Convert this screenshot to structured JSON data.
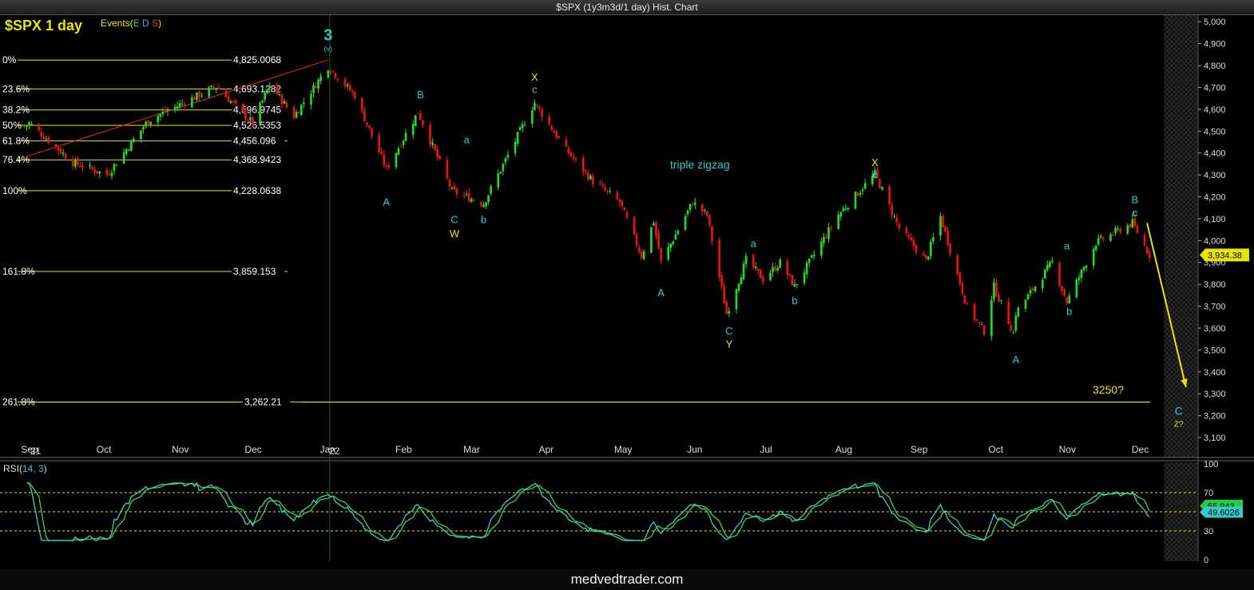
{
  "window": {
    "title": "$SPX (1y3m3d/1 day) Hist. Chart"
  },
  "header": {
    "symbol_label": "$SPX 1 day",
    "events_label": "Events(",
    "events_e": "E",
    "events_d": "D",
    "events_s": "S",
    "events_close": ")"
  },
  "footer": {
    "brand": "medvedtrader.com"
  },
  "colors": {
    "up": "#22dd22",
    "down": "#ee1111",
    "fib": "#e6e600",
    "wave": "#22cccc",
    "yellow": "#e6e600",
    "rsi_a": "#33dddd",
    "rsi_b": "#44dd44"
  },
  "chart_data": {
    "type": "candlestick",
    "price_axis": {
      "ticks": [
        "5,000",
        "4,900",
        "4,800",
        "4,700",
        "4,600",
        "4,500",
        "4,400",
        "4,300",
        "4,200",
        "4,100",
        "4,000",
        "3,900",
        "3,800",
        "3,700",
        "3,600",
        "3,500",
        "3,400",
        "3,300",
        "3,200",
        "3,100"
      ],
      "range": [
        3060,
        5030
      ],
      "last_price": "3,934.38"
    },
    "time_axis": {
      "labels": [
        "Sep",
        "'21",
        "Oct",
        "Nov",
        "Dec",
        "Jan",
        "'22",
        "Feb",
        "Mar",
        "Apr",
        "May",
        "Jun",
        "Jul",
        "Aug",
        "Sep",
        "Oct",
        "Nov",
        "Dec"
      ]
    },
    "fibonacci": {
      "levels": [
        {
          "label": "0%",
          "value": 4825.0068,
          "value_text": "4,825.0068"
        },
        {
          "label": "23.6%",
          "value": 4693.1282,
          "value_text": "4,693.1282"
        },
        {
          "label": "38.2%",
          "value": 4596.9745,
          "value_text": "4,596.9745"
        },
        {
          "label": "50%",
          "value": 4526.5353,
          "value_text": "4,526.5353"
        },
        {
          "label": "61.8%",
          "value": 4456.096,
          "value_text": "4,456.096"
        },
        {
          "label": "76.4%",
          "value": 4368.9423,
          "value_text": "4,368.9423"
        },
        {
          "label": "100%",
          "value": 4228.0638,
          "value_text": "4,228.0638"
        },
        {
          "label": "161.8%",
          "value": 3859.153,
          "value_text": "3,859.153"
        },
        {
          "label": "261.8%",
          "value": 3262.21,
          "value_text": "3,262.21"
        }
      ]
    },
    "annotations": [
      {
        "text": "3",
        "date": "2022-01-03",
        "price": 4915,
        "color": "wave",
        "size": 20,
        "bold": true
      },
      {
        "text": "(v)",
        "date": "2022-01-03",
        "price": 4865,
        "color": "wave",
        "size": 9
      },
      {
        "text": "A",
        "date": "2022-01-27",
        "price": 4160,
        "color": "wave"
      },
      {
        "text": "B",
        "date": "2022-02-10",
        "price": 4650,
        "color": "wave"
      },
      {
        "text": "a",
        "date": "2022-03-01",
        "price": 4445,
        "color": "wave"
      },
      {
        "text": "C",
        "date": "2022-02-24",
        "price": 4080,
        "color": "wave"
      },
      {
        "text": "W",
        "date": "2022-02-24",
        "price": 4015,
        "color": "yellow"
      },
      {
        "text": "b",
        "date": "2022-03-08",
        "price": 4080,
        "color": "wave"
      },
      {
        "text": "X",
        "date": "2022-03-29",
        "price": 4730,
        "color": "yellow"
      },
      {
        "text": "c",
        "date": "2022-03-29",
        "price": 4675,
        "color": "wave"
      },
      {
        "text": "triple zigzag",
        "date": "2022-06-05",
        "price": 4330,
        "color": "wave",
        "size": 14
      },
      {
        "text": "A",
        "date": "2022-05-20",
        "price": 3745,
        "color": "wave"
      },
      {
        "text": "a",
        "date": "2022-06-27",
        "price": 3970,
        "color": "wave"
      },
      {
        "text": "b",
        "date": "2022-07-14",
        "price": 3710,
        "color": "wave"
      },
      {
        "text": "C",
        "date": "2022-06-17",
        "price": 3570,
        "color": "wave"
      },
      {
        "text": "Y",
        "date": "2022-06-17",
        "price": 3510,
        "color": "yellow"
      },
      {
        "text": "X",
        "date": "2022-08-16",
        "price": 4340,
        "color": "yellow"
      },
      {
        "text": "c",
        "date": "2022-08-16",
        "price": 4285,
        "color": "wave",
        "bold": true
      },
      {
        "text": "A",
        "date": "2022-10-13",
        "price": 3440,
        "color": "wave"
      },
      {
        "text": "a",
        "date": "2022-11-03",
        "price": 3960,
        "color": "wave"
      },
      {
        "text": "b",
        "date": "2022-11-04",
        "price": 3660,
        "color": "wave"
      },
      {
        "text": "B",
        "date": "2022-12-01",
        "price": 4170,
        "color": "wave"
      },
      {
        "text": "c",
        "date": "2022-12-01",
        "price": 4110,
        "color": "wave",
        "bold": true
      },
      {
        "text": "3250?",
        "date": "2022-11-20",
        "price": 3300,
        "color": "yellow",
        "size": 14
      },
      {
        "text": "C",
        "date": "2022-12-19",
        "price": 3205,
        "color": "wave",
        "size": 14
      },
      {
        "text": "Z?",
        "date": "2022-12-19",
        "price": 3150,
        "color": "yellow",
        "size": 10
      }
    ],
    "projection": {
      "from_date": "2022-12-06",
      "from_price": 4080,
      "to_date": "2022-12-22",
      "to_price": 3330
    },
    "swing_line": {
      "from_date": "2021-09-01",
      "from_price": 4385,
      "to_date": "2022-01-03",
      "to_price": 4825
    },
    "anchors": [
      [
        "2021-08-31",
        4520
      ],
      [
        "2021-09-02",
        4537
      ],
      [
        "2021-09-20",
        4358
      ],
      [
        "2021-10-04",
        4300
      ],
      [
        "2021-10-21",
        4549
      ],
      [
        "2021-11-18",
        4704
      ],
      [
        "2021-11-30",
        4567
      ],
      [
        "2021-12-03",
        4538
      ],
      [
        "2021-12-10",
        4712
      ],
      [
        "2021-12-20",
        4568
      ],
      [
        "2022-01-03",
        4796
      ],
      [
        "2022-01-14",
        4663
      ],
      [
        "2022-01-27",
        4326
      ],
      [
        "2022-02-09",
        4587
      ],
      [
        "2022-02-23",
        4225
      ],
      [
        "2022-03-08",
        4170
      ],
      [
        "2022-03-29",
        4631
      ],
      [
        "2022-04-11",
        4412
      ],
      [
        "2022-04-22",
        4271
      ],
      [
        "2022-05-03",
        4175
      ],
      [
        "2022-05-12",
        3930
      ],
      [
        "2022-05-17",
        4088
      ],
      [
        "2022-05-20",
        3901
      ],
      [
        "2022-06-02",
        4176
      ],
      [
        "2022-06-08",
        4115
      ],
      [
        "2022-06-16",
        3666
      ],
      [
        "2022-06-24",
        3911
      ],
      [
        "2022-07-01",
        3825
      ],
      [
        "2022-07-08",
        3899
      ],
      [
        "2022-07-14",
        3790
      ],
      [
        "2022-08-01",
        4118
      ],
      [
        "2022-08-16",
        4305
      ],
      [
        "2022-08-26",
        4057
      ],
      [
        "2022-09-06",
        3908
      ],
      [
        "2022-09-12",
        4110
      ],
      [
        "2022-09-23",
        3693
      ],
      [
        "2022-09-30",
        3585
      ],
      [
        "2022-10-04",
        3791
      ],
      [
        "2022-10-13",
        3669
      ],
      [
        "2022-10-12",
        3577
      ],
      [
        "2022-10-28",
        3901
      ],
      [
        "2022-11-03",
        3720
      ],
      [
        "2022-11-15",
        3991
      ],
      [
        "2022-11-30",
        4080
      ],
      [
        "2022-12-07",
        3934
      ]
    ],
    "rsi": {
      "label": "RSI(",
      "params": "14, 3",
      "close": ")",
      "ticks": [
        "100",
        "70",
        "30",
        "0"
      ],
      "levels": [
        70,
        50,
        30
      ],
      "current": "55.943",
      "current2": "49.6026",
      "range": [
        0,
        100
      ]
    }
  }
}
